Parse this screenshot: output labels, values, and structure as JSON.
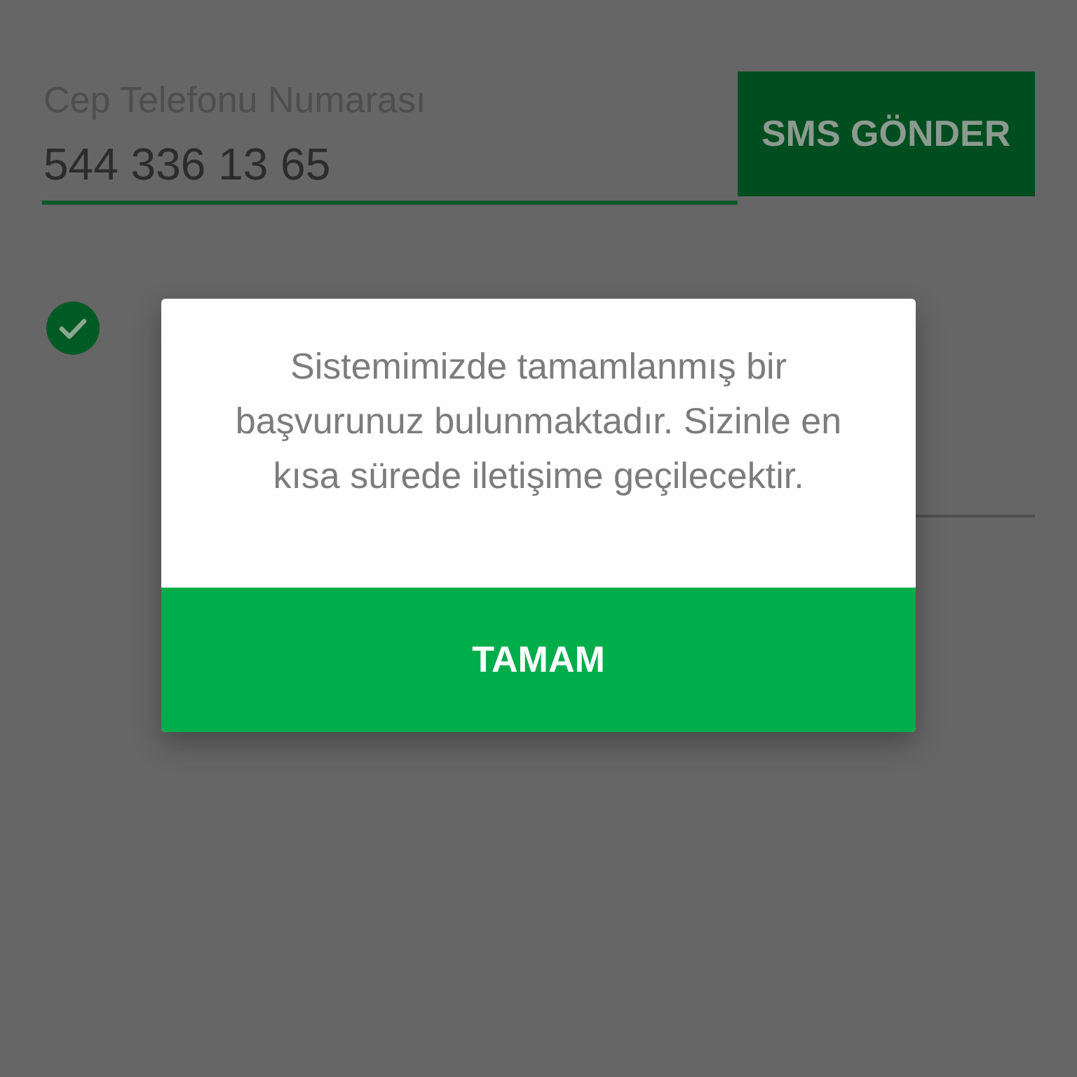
{
  "phone_field": {
    "label": "Cep Telefonu Numarası",
    "value": "544 336 13 65"
  },
  "sms_button": {
    "label": "SMS GÖNDER"
  },
  "consent": {
    "checked": true
  },
  "dialog": {
    "message": "Sistemimizde tamamlanmış bir başvurunuz bulunmaktadır. Sizinle en kısa sürede iletişime geçilecektir.",
    "button": "TAMAM"
  }
}
